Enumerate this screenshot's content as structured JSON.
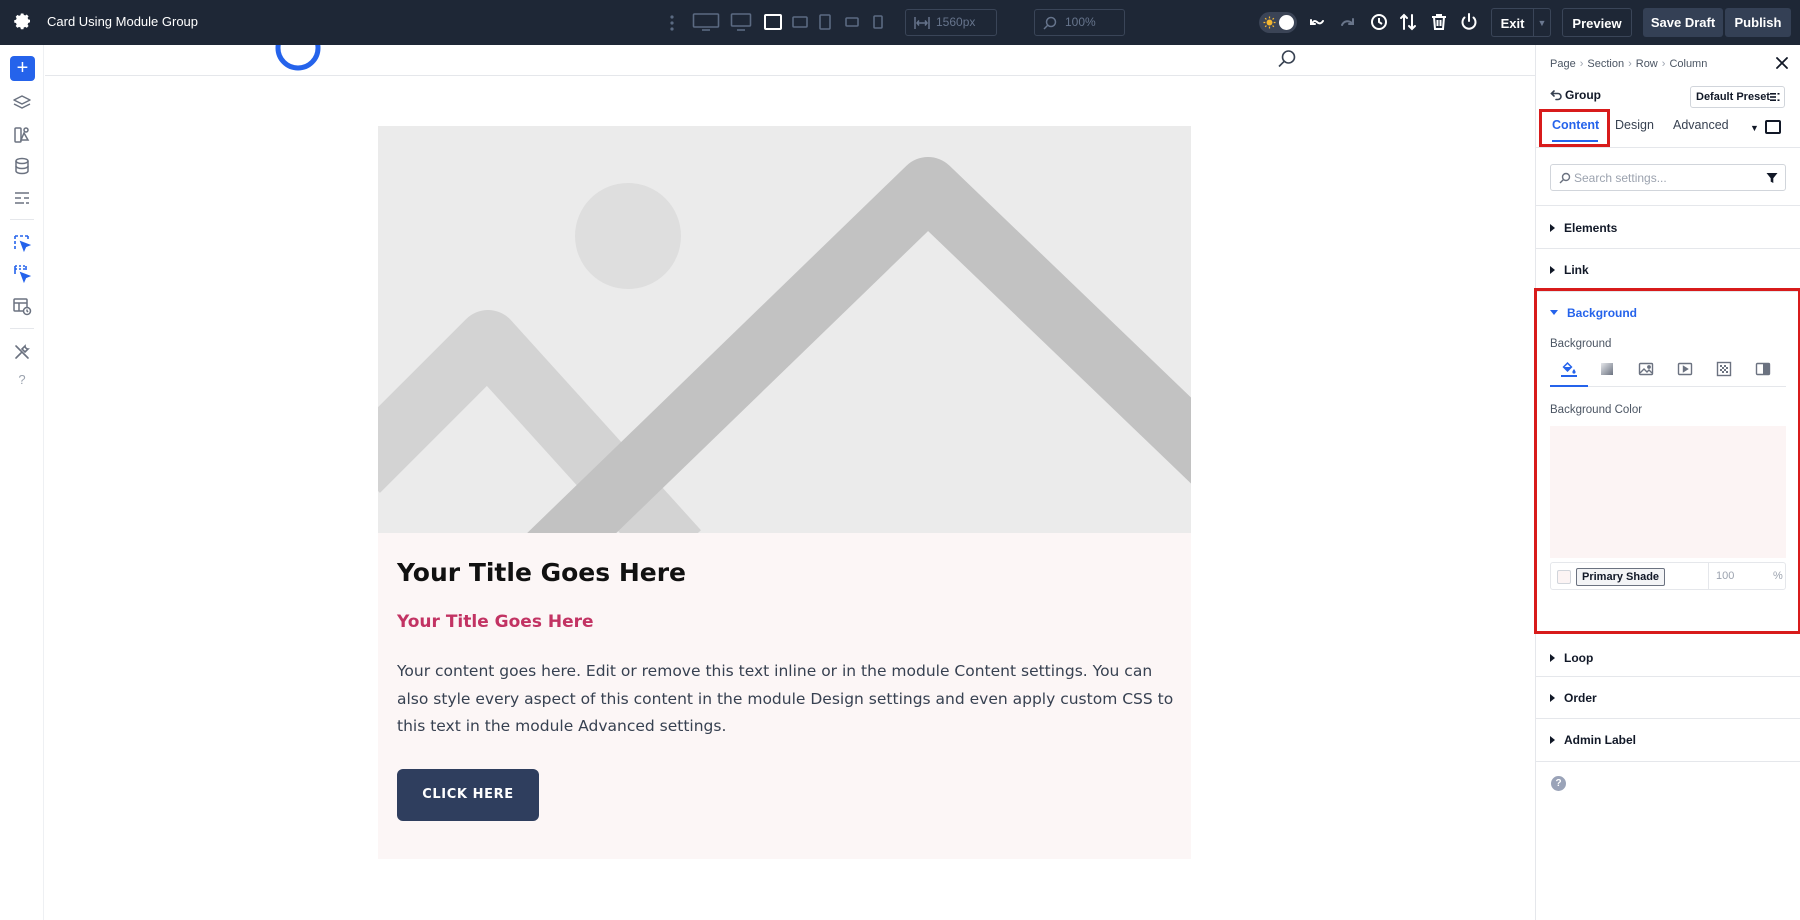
{
  "topbar": {
    "title": "Card Using Module Group",
    "width_value": "1560px",
    "zoom_value": "100%",
    "exit_label": "Exit",
    "preview_label": "Preview",
    "save_draft_label": "Save Draft",
    "publish_label": "Publish",
    "icons": [
      "gear-icon",
      "kebab-icon",
      "desktop-wide-icon",
      "desktop-icon",
      "laptop-icon",
      "tablet-landscape-icon",
      "tablet-icon",
      "phone-landscape-icon",
      "phone-icon",
      "width-icon",
      "zoom-icon",
      "theme-toggle",
      "undo-icon",
      "redo-icon",
      "history-icon",
      "sort-icon",
      "trash-icon",
      "power-icon"
    ]
  },
  "leftrail": {
    "add_label": "+",
    "help_label": "?",
    "icons": [
      "layers-icon",
      "modules-icon",
      "database-icon",
      "layout-icon",
      "select-icon",
      "select-multi-icon",
      "template-icon",
      "tools-icon"
    ]
  },
  "card": {
    "title": "Your Title Goes Here",
    "subtitle": "Your Title Goes Here",
    "body": "Your content goes here. Edit or remove this text inline or in the module Content settings. You can also style every aspect of this content in the module Design settings and even apply custom CSS to this text in the module Advanced settings.",
    "button_label": "CLICK HERE"
  },
  "panel": {
    "breadcrumbs": [
      "Page",
      "Section",
      "Row",
      "Column"
    ],
    "element": "Group",
    "preset": "Default Preset",
    "tabs": [
      "Content",
      "Design",
      "Advanced"
    ],
    "active_tab": "Content",
    "search_placeholder": "Search settings...",
    "sections": {
      "elements": "Elements",
      "link": "Link",
      "background": "Background",
      "loop": "Loop",
      "order": "Order",
      "admin_label": "Admin Label"
    },
    "background": {
      "field_label": "Background",
      "color_label": "Background Color",
      "color_name": "Primary Shade",
      "opacity": "100",
      "opacity_unit": "%",
      "types": [
        "color-fill-icon",
        "gradient-icon",
        "image-icon",
        "video-icon",
        "pattern-icon",
        "mask-icon"
      ],
      "active_type": "color-fill-icon"
    },
    "help_label": "?"
  },
  "colors": {
    "topbar_bg": "#1e2736",
    "accent_blue": "#2563eb",
    "highlight_red": "#d81b1b",
    "card_bg": "#fcf6f6",
    "subtitle_pink": "#c23363",
    "button_navy": "#2f3e5e",
    "swatch_primary_shade": "#fcf4f4"
  }
}
